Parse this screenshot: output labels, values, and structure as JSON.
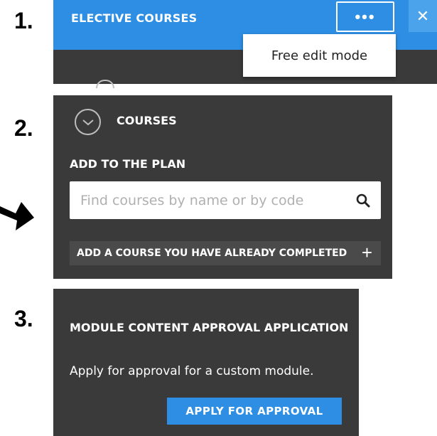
{
  "steps": [
    "1.",
    "2.",
    "3."
  ],
  "panel1": {
    "title": "ELECTIVE COURSES",
    "more_icon": "ellipsis-icon",
    "more_label": "•••",
    "close_icon": "close-icon",
    "close_label": "✕",
    "dropdown_item": "Free edit mode"
  },
  "panel2": {
    "section_title": "COURSES",
    "add_label": "ADD TO THE PLAN",
    "search_placeholder": "Find courses by name or by code",
    "completed_label": "ADD A COURSE YOU HAVE ALREADY COMPLETED",
    "plus_label": "+"
  },
  "panel3": {
    "title": "MODULE CONTENT APPROVAL APPLICATION",
    "description": "Apply for approval for a custom module.",
    "apply_label": "APPLY FOR APPROVAL"
  },
  "colors": {
    "accent": "#2d8ee3",
    "panel_bg": "#3a3a3a",
    "text": "#ffffff"
  }
}
